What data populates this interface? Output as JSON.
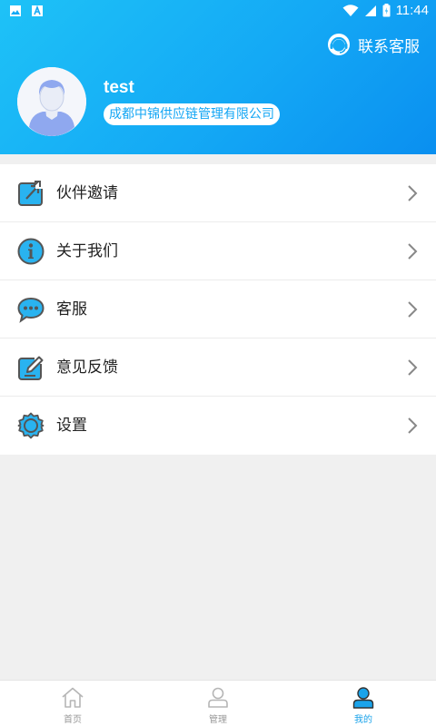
{
  "status_bar": {
    "time": "11:44"
  },
  "header": {
    "contact_label": "联系客服",
    "username": "test",
    "company": "成都中锦供应链管理有限公司"
  },
  "menu": [
    {
      "label": "伙伴邀请",
      "icon": "share-icon"
    },
    {
      "label": "关于我们",
      "icon": "info-icon"
    },
    {
      "label": "客服",
      "icon": "chat-icon"
    },
    {
      "label": "意见反馈",
      "icon": "feedback-icon"
    },
    {
      "label": "设置",
      "icon": "gear-icon"
    }
  ],
  "tabs": [
    {
      "label": "首页",
      "icon": "home-icon",
      "active": false
    },
    {
      "label": "管理",
      "icon": "manage-icon",
      "active": false
    },
    {
      "label": "我的",
      "icon": "profile-icon",
      "active": true
    }
  ],
  "colors": {
    "primary": "#14a9f5",
    "icon_blue": "#29b3f0",
    "icon_outline": "#555555"
  }
}
